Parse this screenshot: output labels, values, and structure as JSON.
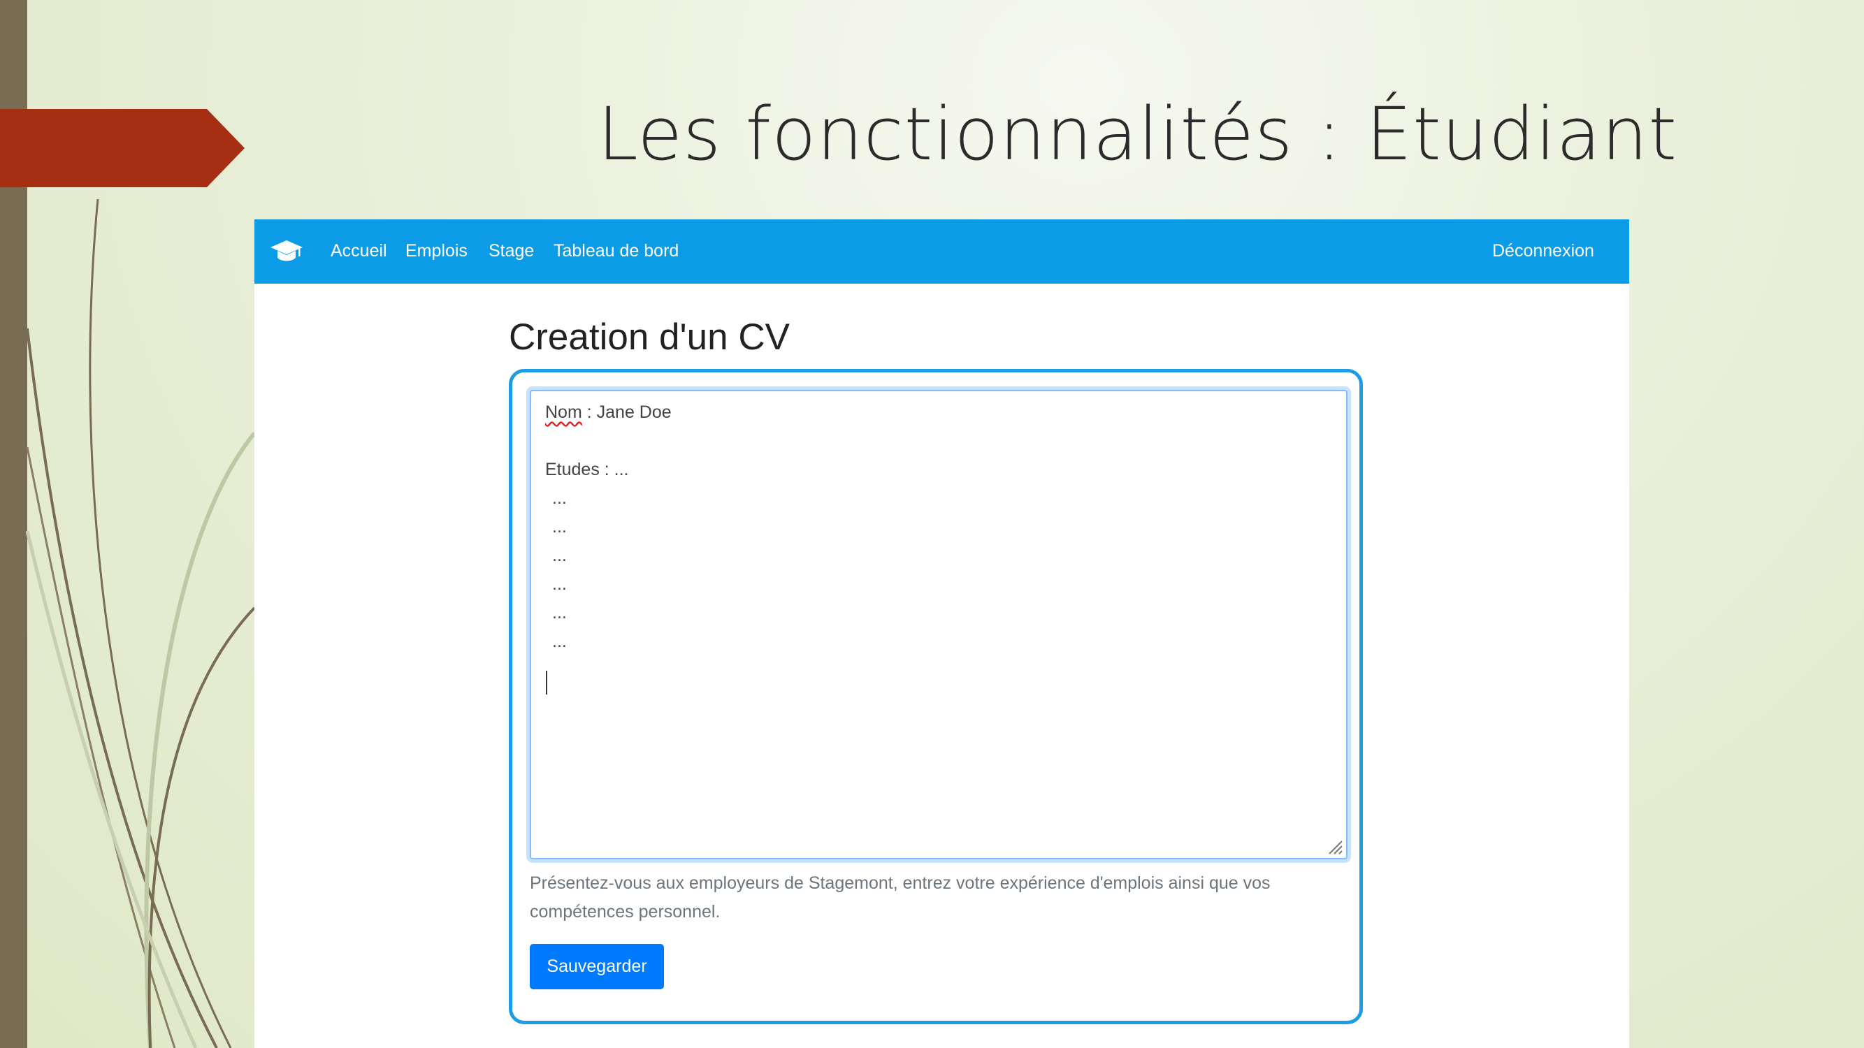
{
  "slide": {
    "title": "Les fonctionnalités : Étudiant"
  },
  "navbar": {
    "brand_icon": "graduation-cap-icon",
    "links": [
      "Accueil",
      "Emplois",
      "Stage",
      "Tableau de bord"
    ],
    "logout_label": "Déconnexion",
    "color": "#0b9be7"
  },
  "form": {
    "title": "Creation d'un CV",
    "textarea": {
      "lines": {
        "nom_label": "Nom",
        "nom_rest": " : Jane Doe",
        "etudes": "Etudes : ...",
        "dots": [
          "...",
          "...",
          "...",
          "...",
          "...",
          "..."
        ]
      }
    },
    "help_text": "Présentez-vous aux employeurs de Stagemont, entrez votre expérience d'emplois ainsi que vos compétences personnel.",
    "save_label": "Sauvegarder",
    "save_color": "#007bff",
    "highlight_color": "#1c9de3"
  }
}
